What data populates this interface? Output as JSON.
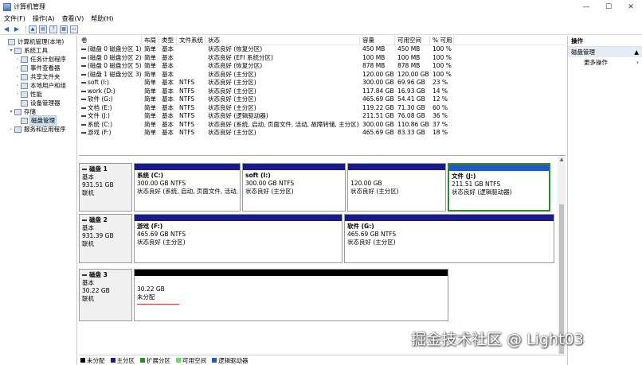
{
  "window": {
    "title": "计算机管理",
    "minimize": "—",
    "maximize": "☐",
    "close": "✕"
  },
  "menu": [
    "文件(F)",
    "操作(A)",
    "查看(V)",
    "帮助(H)"
  ],
  "tree": [
    {
      "label": "计算机管理(本地)",
      "level": 0,
      "exp": "",
      "selected": false
    },
    {
      "label": "系统工具",
      "level": 1,
      "exp": "▾",
      "selected": false
    },
    {
      "label": "任务计划程序",
      "level": 2,
      "exp": "›",
      "selected": false
    },
    {
      "label": "事件查看器",
      "level": 2,
      "exp": "›",
      "selected": false
    },
    {
      "label": "共享文件夹",
      "level": 2,
      "exp": "›",
      "selected": false
    },
    {
      "label": "本地用户和组",
      "level": 2,
      "exp": "›",
      "selected": false
    },
    {
      "label": "性能",
      "level": 2,
      "exp": "›",
      "selected": false
    },
    {
      "label": "设备管理器",
      "level": 2,
      "exp": "",
      "selected": false
    },
    {
      "label": "存储",
      "level": 1,
      "exp": "▾",
      "selected": false
    },
    {
      "label": "磁盘管理",
      "level": 2,
      "exp": "",
      "selected": true
    },
    {
      "label": "服务和应用程序",
      "level": 1,
      "exp": "›",
      "selected": false
    }
  ],
  "volume_list": {
    "headers": [
      "卷",
      "布局",
      "类型",
      "文件系统",
      "状态",
      "容量",
      "可用空间",
      "% 可用"
    ],
    "rows": [
      [
        "(磁盘 0 磁盘分区 1)",
        "简单",
        "基本",
        "",
        "状态良好 (恢复分区)",
        "450 MB",
        "450 MB",
        "100 %"
      ],
      [
        "(磁盘 0 磁盘分区 2)",
        "简单",
        "基本",
        "",
        "状态良好 (EFI 系统分区)",
        "100 MB",
        "100 MB",
        "100 %"
      ],
      [
        "(磁盘 0 磁盘分区 5)",
        "简单",
        "基本",
        "",
        "状态良好 (恢复分区)",
        "878 MB",
        "878 MB",
        "100 %"
      ],
      [
        "(磁盘 1 磁盘分区 3)",
        "简单",
        "基本",
        "",
        "状态良好 (主分区)",
        "120.00 GB",
        "120.00 GB",
        "100 %"
      ],
      [
        "soft (I:)",
        "简单",
        "基本",
        "NTFS",
        "状态良好 (主分区)",
        "300.00 GB",
        "69.96 GB",
        "23 %"
      ],
      [
        "work (D:)",
        "简单",
        "基本",
        "NTFS",
        "状态良好 (主分区)",
        "117.84 GB",
        "16.93 GB",
        "14 %"
      ],
      [
        "软件 (G:)",
        "简单",
        "基本",
        "NTFS",
        "状态良好 (主分区)",
        "465.69 GB",
        "54.41 GB",
        "12 %"
      ],
      [
        "文档 (E:)",
        "简单",
        "基本",
        "NTFS",
        "状态良好 (主分区)",
        "119.22 GB",
        "71.30 GB",
        "60 %"
      ],
      [
        "文件 (J:)",
        "简单",
        "基本",
        "NTFS",
        "状态良好 (逻辑驱动器)",
        "211.51 GB",
        "76.08 GB",
        "36 %"
      ],
      [
        "系统 (C:)",
        "简单",
        "基本",
        "NTFS",
        "状态良好 (系统, 启动, 页面文件, 活动, 故障转储, 主分区)",
        "300.00 GB",
        "110.86 GB",
        "37 %"
      ],
      [
        "游戏 (F:)",
        "简单",
        "基本",
        "NTFS",
        "状态良好 (主分区)",
        "465.69 GB",
        "83.33 GB",
        "18 %"
      ]
    ]
  },
  "disks": [
    {
      "name": "磁盘 1",
      "type": "基本",
      "size": "931.51 GB",
      "status": "联机",
      "partitions": [
        {
          "name": "系统 (C:)",
          "size": "300.00 GB NTFS",
          "status": "状态良好 (系统, 启动, 页面文件, 活动,",
          "kind": "primary"
        },
        {
          "name": "soft (I:)",
          "size": "300.00 GB NTFS",
          "status": "状态良好 (主分区)",
          "kind": "primary"
        },
        {
          "name": "",
          "size": "120.00 GB",
          "status": "状态良好 (主分区)",
          "kind": "primary"
        },
        {
          "name": "文件 (J:)",
          "size": "211.51 GB NTFS",
          "status": "状态良好 (逻辑驱动器)",
          "kind": "logical"
        }
      ]
    },
    {
      "name": "磁盘 2",
      "type": "基本",
      "size": "931.39 GB",
      "status": "联机",
      "partitions": [
        {
          "name": "游戏 (F:)",
          "size": "465.69 GB NTFS",
          "status": "状态良好 (主分区)",
          "kind": "primary"
        },
        {
          "name": "软件 (G:)",
          "size": "465.69 GB NTFS",
          "status": "状态良好 (主分区)",
          "kind": "primary"
        }
      ]
    },
    {
      "name": "磁盘 3",
      "type": "基本",
      "size": "30.22 GB",
      "status": "联机",
      "partitions": [
        {
          "name": "",
          "size": "30.22 GB",
          "status": "未分配",
          "kind": "unallocated"
        }
      ]
    }
  ],
  "legend": [
    {
      "label": "未分配",
      "color": "#000000"
    },
    {
      "label": "主分区",
      "color": "#1a1a8c"
    },
    {
      "label": "扩展分区",
      "color": "#2e8b2e"
    },
    {
      "label": "可用空间",
      "color": "#5ee35e"
    },
    {
      "label": "逻辑驱动器",
      "color": "#2255c8"
    }
  ],
  "actions": {
    "header": "操作",
    "section": "磁盘管理",
    "more": "更多操作",
    "section_arrow": "▲",
    "more_arrow": "›"
  },
  "watermark": "掘金技术社区 @ Light03"
}
